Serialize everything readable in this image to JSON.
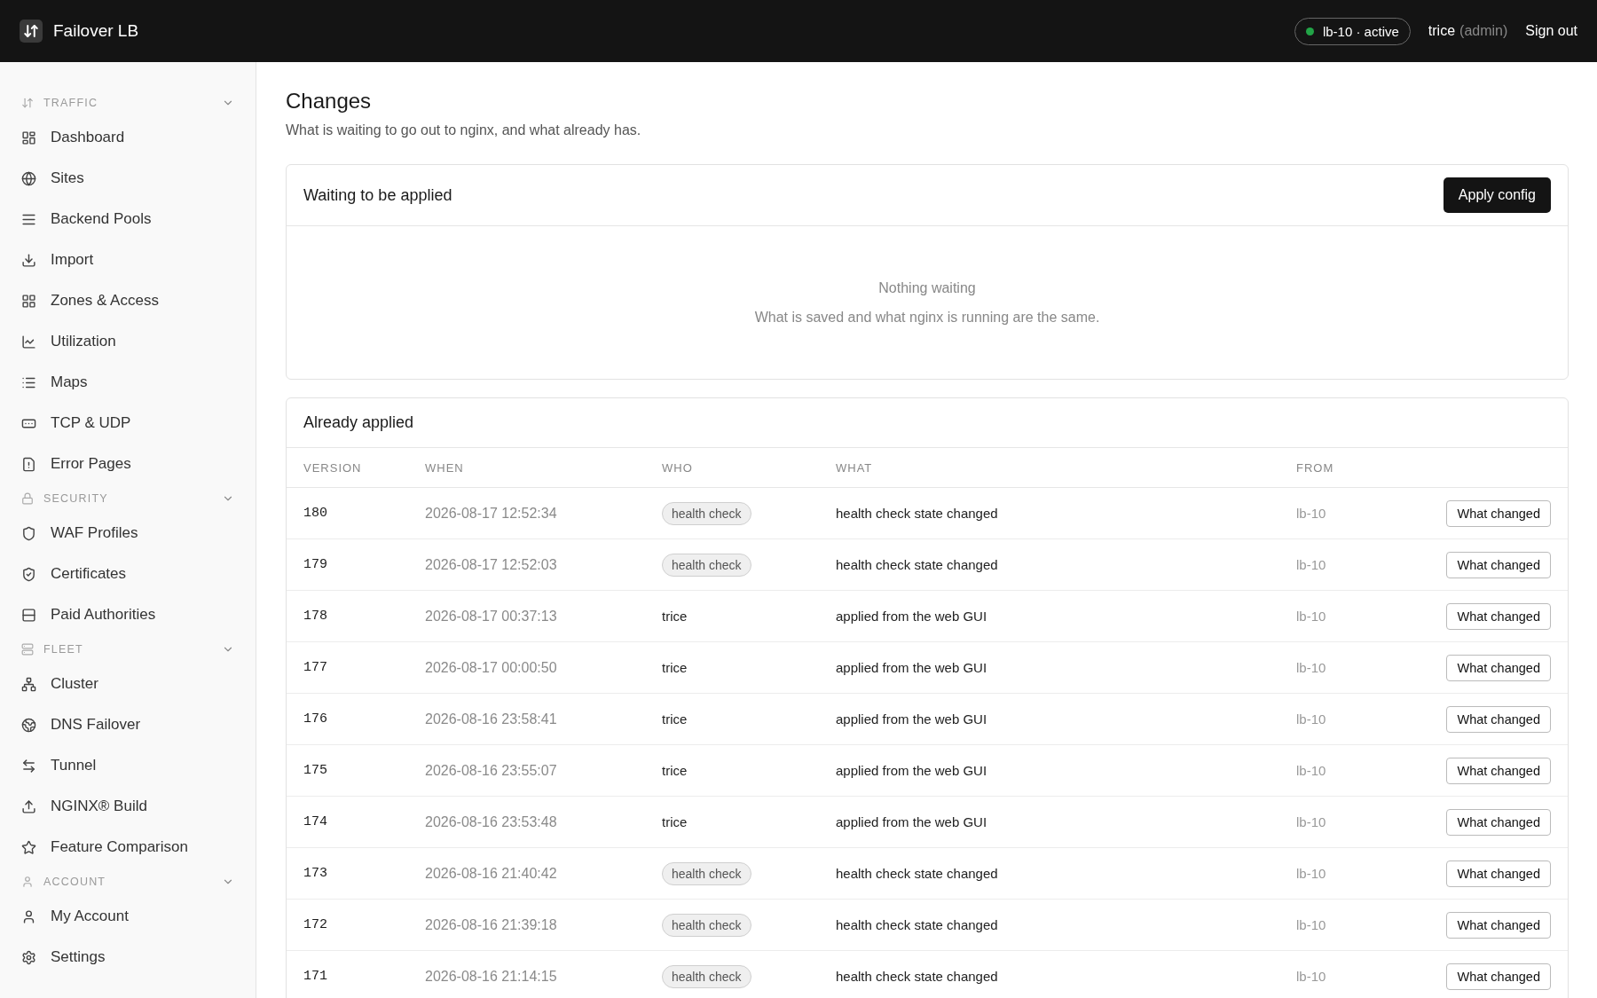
{
  "app": {
    "name": "Failover LB"
  },
  "header": {
    "node": {
      "label": "lb-10 · active",
      "color": "#22a447"
    },
    "user": "trice",
    "role": "(admin)",
    "sign_out": "Sign out"
  },
  "sidebar": {
    "groups": [
      {
        "title": "TRAFFIC",
        "expanded": true,
        "items": [
          {
            "label": "Dashboard"
          },
          {
            "label": "Sites"
          },
          {
            "label": "Backend Pools"
          },
          {
            "label": "Import"
          },
          {
            "label": "Zones & Access"
          },
          {
            "label": "Utilization"
          },
          {
            "label": "Maps"
          },
          {
            "label": "TCP & UDP"
          },
          {
            "label": "Error Pages"
          }
        ]
      },
      {
        "title": "SECURITY",
        "expanded": true,
        "items": [
          {
            "label": "WAF Profiles"
          },
          {
            "label": "Certificates"
          },
          {
            "label": "Paid Authorities"
          }
        ]
      },
      {
        "title": "FLEET",
        "expanded": true,
        "items": [
          {
            "label": "Cluster"
          },
          {
            "label": "DNS Failover"
          },
          {
            "label": "Tunnel"
          },
          {
            "label": "NGINX® Build"
          },
          {
            "label": "Feature Comparison"
          }
        ]
      },
      {
        "title": "ACCOUNT",
        "expanded": true,
        "items": [
          {
            "label": "My Account"
          },
          {
            "label": "Settings"
          }
        ]
      }
    ]
  },
  "page": {
    "title": "Changes",
    "subtitle": "What is waiting to go out to nginx, and what already has."
  },
  "pending": {
    "title": "Waiting to be applied",
    "button": "Apply config",
    "empty_title": "Nothing waiting",
    "empty_text": "What is saved and what nginx is running are the same."
  },
  "applied": {
    "title": "Already applied",
    "columns": [
      "VERSION",
      "WHEN",
      "WHO",
      "WHAT",
      "FROM"
    ],
    "rows": [
      {
        "version": "180",
        "when": "2026-08-17 12:52:34",
        "who": {
          "kind": "tag",
          "text": "health check"
        },
        "what": "health check state changed",
        "from": "lb-10",
        "action": "What changed"
      },
      {
        "version": "179",
        "when": "2026-08-17 12:52:03",
        "who": {
          "kind": "tag",
          "text": "health check"
        },
        "what": "health check state changed",
        "from": "lb-10",
        "action": "What changed"
      },
      {
        "version": "178",
        "when": "2026-08-17 00:37:13",
        "who": {
          "kind": "user",
          "text": "trice"
        },
        "what": "applied from the web GUI",
        "from": "lb-10",
        "action": "What changed"
      },
      {
        "version": "177",
        "when": "2026-08-17 00:00:50",
        "who": {
          "kind": "user",
          "text": "trice"
        },
        "what": "applied from the web GUI",
        "from": "lb-10",
        "action": "What changed"
      },
      {
        "version": "176",
        "when": "2026-08-16 23:58:41",
        "who": {
          "kind": "user",
          "text": "trice"
        },
        "what": "applied from the web GUI",
        "from": "lb-10",
        "action": "What changed"
      },
      {
        "version": "175",
        "when": "2026-08-16 23:55:07",
        "who": {
          "kind": "user",
          "text": "trice"
        },
        "what": "applied from the web GUI",
        "from": "lb-10",
        "action": "What changed"
      },
      {
        "version": "174",
        "when": "2026-08-16 23:53:48",
        "who": {
          "kind": "user",
          "text": "trice"
        },
        "what": "applied from the web GUI",
        "from": "lb-10",
        "action": "What changed"
      },
      {
        "version": "173",
        "when": "2026-08-16 21:40:42",
        "who": {
          "kind": "tag",
          "text": "health check"
        },
        "what": "health check state changed",
        "from": "lb-10",
        "action": "What changed"
      },
      {
        "version": "172",
        "when": "2026-08-16 21:39:18",
        "who": {
          "kind": "tag",
          "text": "health check"
        },
        "what": "health check state changed",
        "from": "lb-10",
        "action": "What changed"
      },
      {
        "version": "171",
        "when": "2026-08-16 21:14:15",
        "who": {
          "kind": "tag",
          "text": "health check"
        },
        "what": "health check state changed",
        "from": "lb-10",
        "action": "What changed"
      }
    ]
  }
}
